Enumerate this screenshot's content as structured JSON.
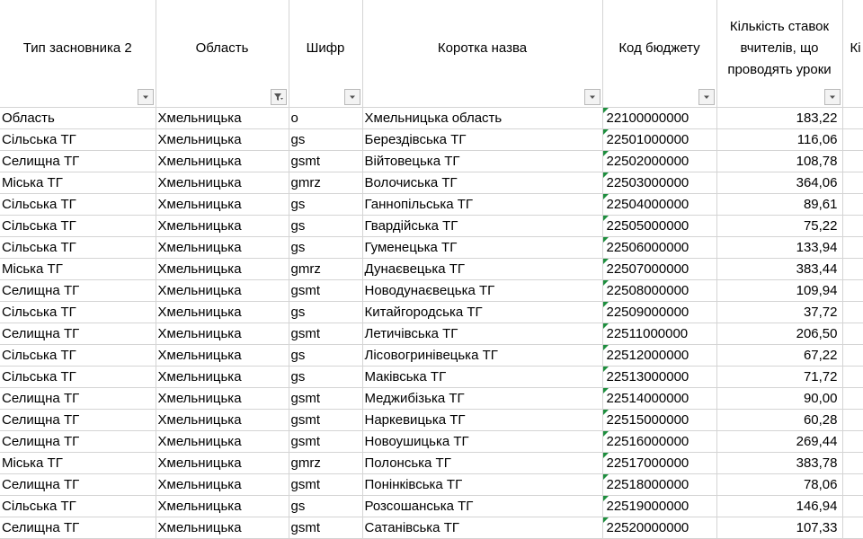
{
  "headers": [
    {
      "label": "Тип засновника 2",
      "filter": "dropdown"
    },
    {
      "label": "Область",
      "filter": "funnel"
    },
    {
      "label": "Шифр",
      "filter": "dropdown"
    },
    {
      "label": "Коротка назва",
      "filter": "dropdown"
    },
    {
      "label": "Код бюджету",
      "filter": "dropdown"
    },
    {
      "label": "Кількість ставок вчителів, що проводять уроки",
      "filter": "dropdown"
    },
    {
      "label": "Кі пр",
      "filter": "none"
    }
  ],
  "rows": [
    [
      "Область",
      "Хмельницька",
      "o",
      "Хмельницька область",
      "22100000000",
      "183,22"
    ],
    [
      "Сільська ТГ",
      "Хмельницька",
      "gs",
      "Берездівська ТГ",
      "22501000000",
      "116,06"
    ],
    [
      "Селищна ТГ",
      "Хмельницька",
      "gsmt",
      "Війтовецька ТГ",
      "22502000000",
      "108,78"
    ],
    [
      "Міська ТГ",
      "Хмельницька",
      "gmrz",
      "Волочиська ТГ",
      "22503000000",
      "364,06"
    ],
    [
      "Сільська ТГ",
      "Хмельницька",
      "gs",
      "Ганнопільська ТГ",
      "22504000000",
      "89,61"
    ],
    [
      "Сільська ТГ",
      "Хмельницька",
      "gs",
      "Гвардійська ТГ",
      "22505000000",
      "75,22"
    ],
    [
      "Сільська ТГ",
      "Хмельницька",
      "gs",
      "Гуменецька ТГ",
      "22506000000",
      "133,94"
    ],
    [
      "Міська ТГ",
      "Хмельницька",
      "gmrz",
      "Дунаєвецька ТГ",
      "22507000000",
      "383,44"
    ],
    [
      "Селищна ТГ",
      "Хмельницька",
      "gsmt",
      "Новодунаєвецька ТГ",
      "22508000000",
      "109,94"
    ],
    [
      "Сільська ТГ",
      "Хмельницька",
      "gs",
      "Китайгородська ТГ",
      "22509000000",
      "37,72"
    ],
    [
      "Селищна ТГ",
      "Хмельницька",
      "gsmt",
      "Летичівська ТГ",
      "22511000000",
      "206,50"
    ],
    [
      "Сільська ТГ",
      "Хмельницька",
      "gs",
      "Лісовогринівецька ТГ",
      "22512000000",
      "67,22"
    ],
    [
      "Сільська ТГ",
      "Хмельницька",
      "gs",
      "Маківська ТГ",
      "22513000000",
      "71,72"
    ],
    [
      "Селищна ТГ",
      "Хмельницька",
      "gsmt",
      "Меджибізька ТГ",
      "22514000000",
      "90,00"
    ],
    [
      "Селищна ТГ",
      "Хмельницька",
      "gsmt",
      "Наркевицька ТГ",
      "22515000000",
      "60,28"
    ],
    [
      "Селищна ТГ",
      "Хмельницька",
      "gsmt",
      "Новоушицька ТГ",
      "22516000000",
      "269,44"
    ],
    [
      "Міська ТГ",
      "Хмельницька",
      "gmrz",
      "Полонська ТГ",
      "22517000000",
      "383,78"
    ],
    [
      "Селищна ТГ",
      "Хмельницька",
      "gsmt",
      "Понінківська ТГ",
      "22518000000",
      "78,06"
    ],
    [
      "Сільська ТГ",
      "Хмельницька",
      "gs",
      "Розсошанська ТГ",
      "22519000000",
      "146,94"
    ],
    [
      "Селищна ТГ",
      "Хмельницька",
      "gsmt",
      "Сатанівська ТГ",
      "22520000000",
      "107,33"
    ]
  ],
  "colors": {
    "gridline": "#d4d4d4",
    "text_indicator": "#1e8e3e",
    "filter_button": "#f3f3f3"
  },
  "icons": {
    "dropdown": "dropdown-arrow-icon",
    "funnel": "filter-funnel-icon"
  }
}
